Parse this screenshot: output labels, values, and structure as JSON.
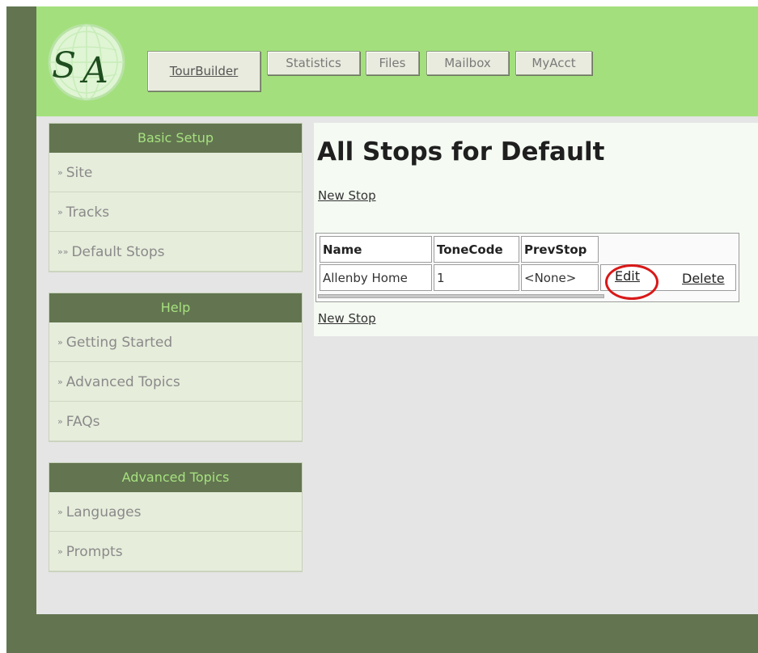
{
  "header": {
    "logo_text": "SA",
    "tabs": [
      {
        "label": "TourBuilder",
        "active": true
      },
      {
        "label": "Statistics",
        "active": false
      },
      {
        "label": "Files",
        "active": false
      },
      {
        "label": "Mailbox",
        "active": false
      },
      {
        "label": "MyAcct",
        "active": false
      }
    ]
  },
  "sidebar": {
    "panels": [
      {
        "title": "Basic Setup",
        "items": [
          {
            "arrow": "»",
            "label": "Site"
          },
          {
            "arrow": "»",
            "label": "Tracks"
          },
          {
            "arrow": "»»",
            "label": "Default Stops"
          }
        ]
      },
      {
        "title": "Help",
        "items": [
          {
            "arrow": "»",
            "label": "Getting Started"
          },
          {
            "arrow": "»",
            "label": "Advanced Topics"
          },
          {
            "arrow": "»",
            "label": "FAQs"
          }
        ]
      },
      {
        "title": "Advanced Topics",
        "items": [
          {
            "arrow": "»",
            "label": "Languages"
          },
          {
            "arrow": "»",
            "label": "Prompts"
          }
        ]
      }
    ]
  },
  "main": {
    "title": "All Stops for Default",
    "new_stop_label": "New Stop",
    "table": {
      "headers": [
        "Name",
        "ToneCode",
        "PrevStop"
      ],
      "rows": [
        {
          "name": "Allenby Home",
          "tonecode": "1",
          "prevstop": "<None>",
          "edit": "Edit",
          "delete": "Delete"
        }
      ]
    }
  },
  "colors": {
    "frame": "#627550",
    "header_bg": "#a3e07d",
    "panel_title": "#a7e07f",
    "highlight_circle": "#d81818"
  }
}
